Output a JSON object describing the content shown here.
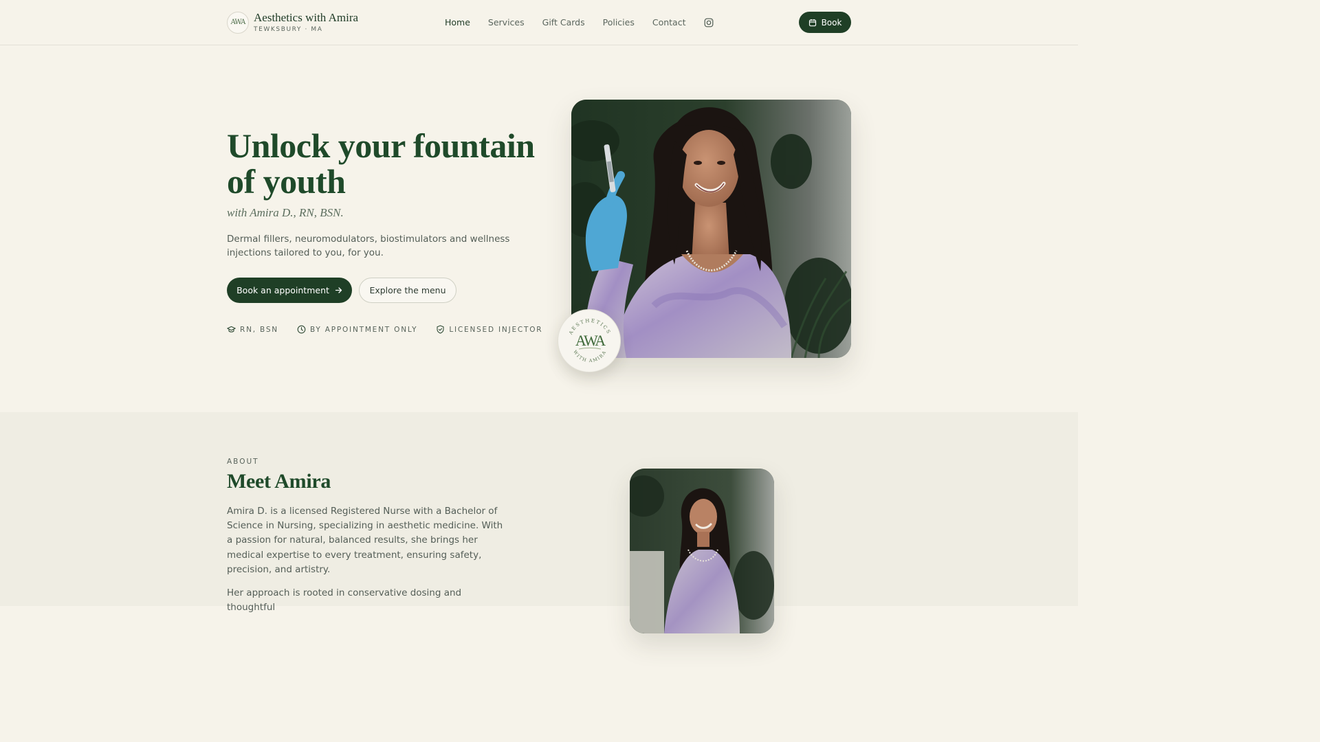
{
  "header": {
    "logo_monogram": "AWA",
    "brand_name": "Aesthetics with Amira",
    "brand_location": "TEWKSBURY · MA",
    "nav": [
      {
        "label": "Home",
        "active": true
      },
      {
        "label": "Services"
      },
      {
        "label": "Gift Cards"
      },
      {
        "label": "Policies"
      },
      {
        "label": "Contact"
      }
    ],
    "instagram_icon": "instagram-icon",
    "book_label": "Book"
  },
  "hero": {
    "title": "Unlock your fountain of youth",
    "subtitle": "with Amira D., RN, BSN.",
    "description": "Dermal fillers, neuromodulators, biostimulators and wellness injections tailored to you, for you.",
    "primary_cta": "Book an appointment",
    "secondary_cta": "Explore the menu",
    "badges": [
      {
        "icon": "graduation-cap-icon",
        "label": "RN, BSN"
      },
      {
        "icon": "clock-icon",
        "label": "BY APPOINTMENT ONLY"
      },
      {
        "icon": "shield-check-icon",
        "label": "LICENSED INJECTOR"
      }
    ],
    "seal_monogram": "AWA",
    "seal_top_text": "AESTHETICS",
    "seal_bottom_text": "WITH AMIRA"
  },
  "about": {
    "eyebrow": "ABOUT",
    "title": "Meet Amira",
    "paragraph_1": "Amira D. is a licensed Registered Nurse with a Bachelor of Science in Nursing, specializing in aesthetic medicine. With a passion for natural, balanced results, she brings her medical expertise to every treatment, ensuring safety, precision, and artistry.",
    "paragraph_2": "Her approach is rooted in conservative dosing and thoughtful"
  },
  "colors": {
    "brand_green": "#1f3f26",
    "page_bg": "#f6f3ea",
    "section_bg": "#efede3"
  }
}
